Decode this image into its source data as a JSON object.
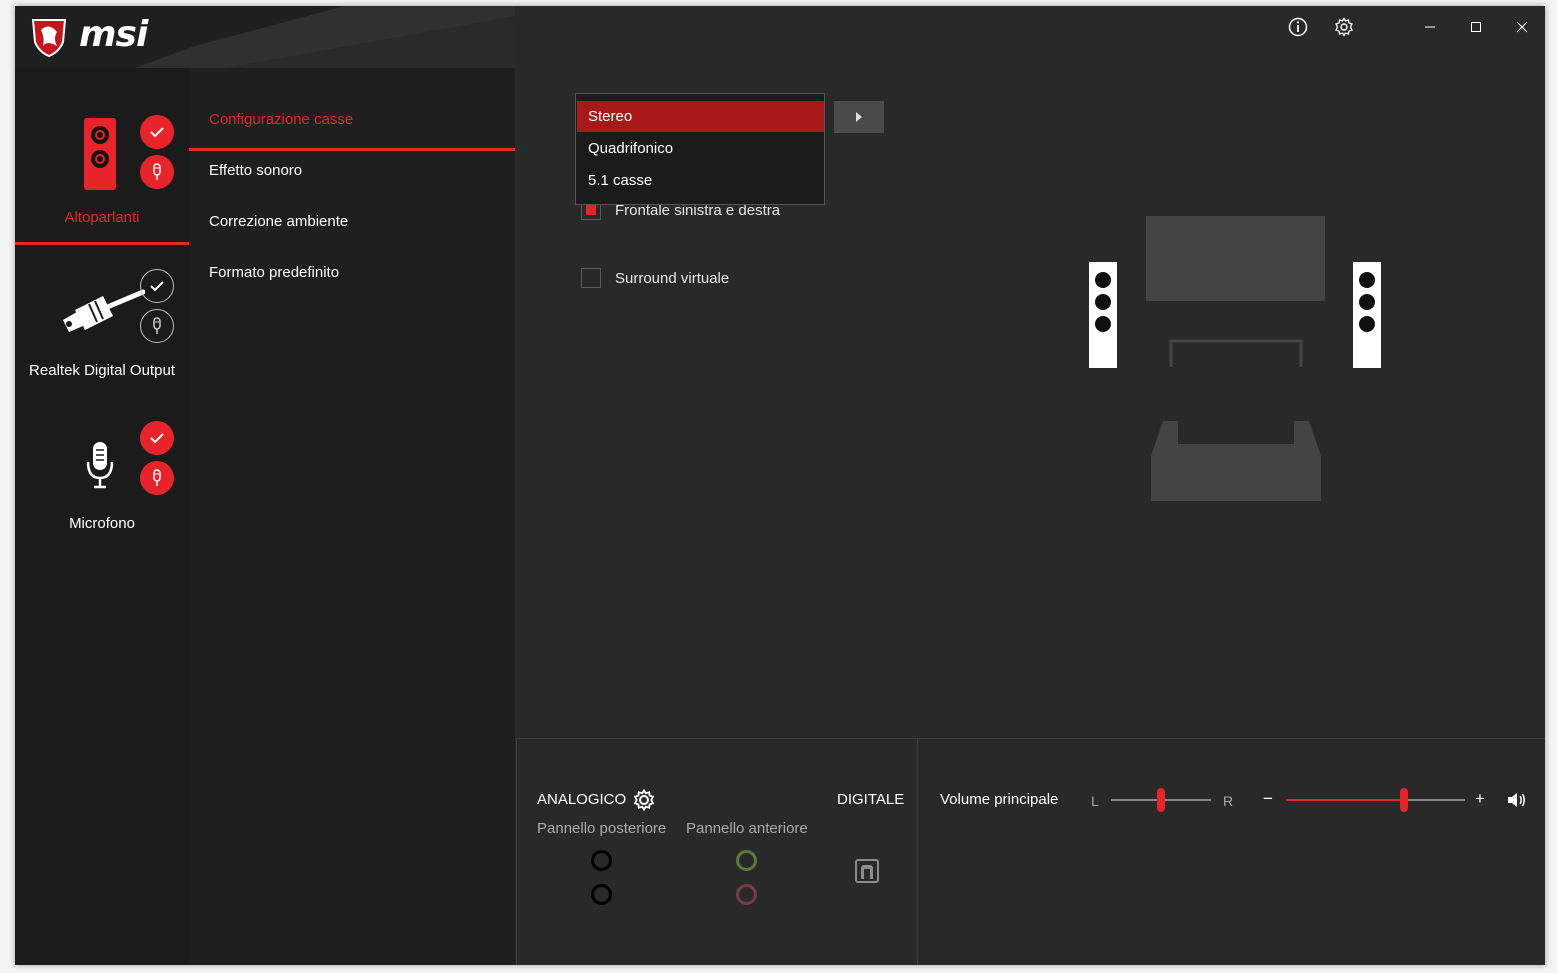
{
  "app": {
    "logo_text": "msi"
  },
  "devices": [
    {
      "label": "Altoparlanti",
      "active": true
    },
    {
      "label": "Realtek Digital Output",
      "active": false
    },
    {
      "label": "Microfono",
      "active": false
    }
  ],
  "menu": {
    "items": [
      {
        "label": "Configurazione casse",
        "active": true
      },
      {
        "label": "Effetto sonoro",
        "active": false
      },
      {
        "label": "Correzione ambiente",
        "active": false
      },
      {
        "label": "Formato predefinito",
        "active": false
      }
    ]
  },
  "speaker_config": {
    "dropdown_options": [
      "Stereo",
      "Quadrifonico",
      "5.1 casse"
    ],
    "selected": "Stereo",
    "front_lr_label": "Frontale sinistra e destra",
    "front_lr_checked": true,
    "virtual_surround_label": "Surround virtuale",
    "virtual_surround_checked": false
  },
  "bottom": {
    "analog_label": "ANALOGICO",
    "digital_label": "DIGITALE",
    "rear_panel_label": "Pannello posteriore",
    "front_panel_label": "Pannello anteriore",
    "volume_label": "Volume principale",
    "balance_left": "L",
    "balance_right": "R",
    "volume_minus": "−",
    "volume_plus": "+",
    "balance_level": 0.5,
    "volume_level": 0.66
  },
  "colors": {
    "accent": "#e8232a",
    "selected": "#a81a1a",
    "jack_green": "#5a7a3a",
    "jack_pink": "#7a3a4a"
  },
  "icons": [
    "info-icon",
    "settings-gear-icon",
    "minimize-icon",
    "maximize-icon",
    "close-icon",
    "speaker-icon"
  ]
}
